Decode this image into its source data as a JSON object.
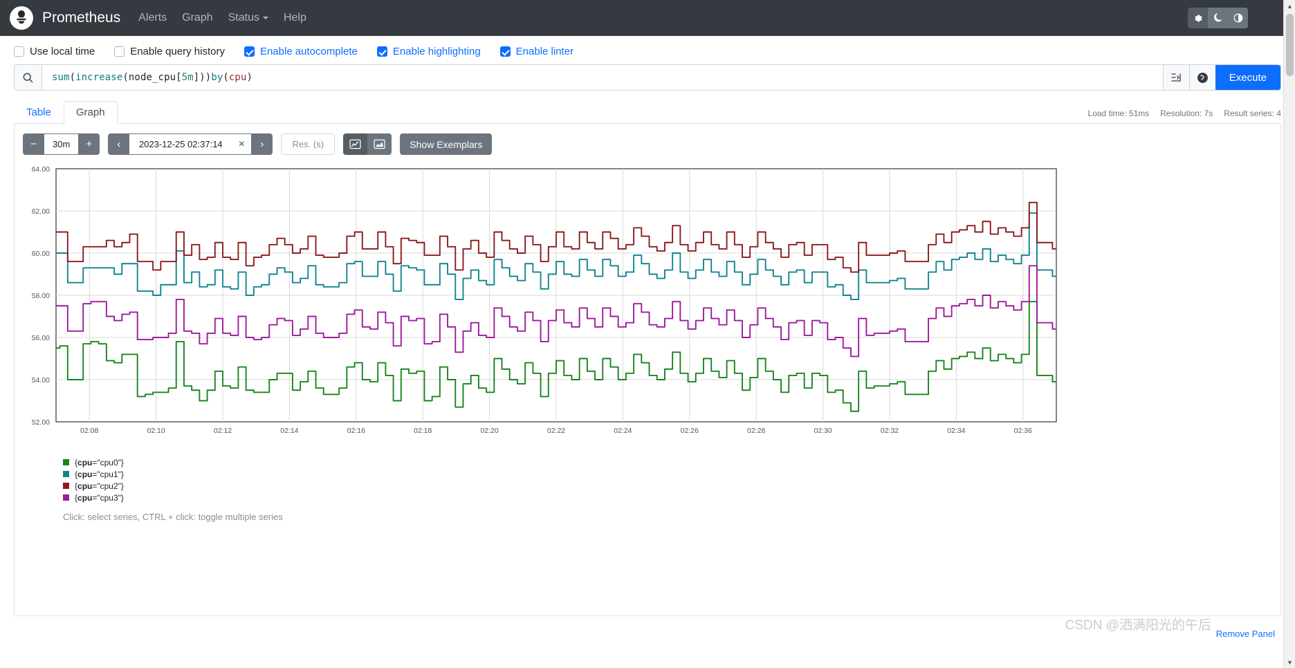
{
  "navbar": {
    "logo_icon": "prometheus-logo-icon",
    "brand": "Prometheus",
    "links": [
      {
        "label": "Alerts",
        "caret": false
      },
      {
        "label": "Graph",
        "caret": false
      },
      {
        "label": "Status",
        "caret": true
      },
      {
        "label": "Help",
        "caret": false
      }
    ],
    "theme_buttons": [
      {
        "name": "gear-icon",
        "glyph": "⚙",
        "selected": true
      },
      {
        "name": "moon-icon",
        "glyph": "☾",
        "selected": false
      },
      {
        "name": "contrast-icon",
        "glyph": "◑",
        "selected": false
      }
    ]
  },
  "options": [
    {
      "label": "Use local time",
      "checked": false,
      "accent": false
    },
    {
      "label": "Enable query history",
      "checked": false,
      "accent": false
    },
    {
      "label": "Enable autocomplete",
      "checked": true,
      "accent": true
    },
    {
      "label": "Enable highlighting",
      "checked": true,
      "accent": true
    },
    {
      "label": "Enable linter",
      "checked": true,
      "accent": true
    }
  ],
  "query": {
    "search_icon": "search-icon",
    "expression": "sum(increase(node_cpu[5m])) by (cpu)",
    "tokens": [
      {
        "t": "sum",
        "k": "fn"
      },
      {
        "t": "(",
        "k": "punc"
      },
      {
        "t": "increase",
        "k": "fn"
      },
      {
        "t": "(",
        "k": "punc"
      },
      {
        "t": "node_cpu",
        "k": "id"
      },
      {
        "t": "[",
        "k": "punc"
      },
      {
        "t": "5m",
        "k": "num"
      },
      {
        "t": "])) ",
        "k": "punc"
      },
      {
        "t": "by",
        "k": "kw"
      },
      {
        "t": " (",
        "k": "punc"
      },
      {
        "t": "cpu",
        "k": "lbl"
      },
      {
        "t": ")",
        "k": "punc"
      }
    ],
    "format_icon": "format-expression-icon",
    "metrics_explorer_icon": "metrics-explorer-icon",
    "execute_label": "Execute"
  },
  "tabs": [
    {
      "label": "Table",
      "active": false
    },
    {
      "label": "Graph",
      "active": true
    }
  ],
  "stats": {
    "load_time": "Load time: 51ms",
    "resolution": "Resolution: 7s",
    "result_series": "Result series: 4"
  },
  "graph_controls": {
    "decrease_range": "−",
    "range_value": "30m",
    "increase_range": "+",
    "prev_label": "‹",
    "end_time": "2023-12-25 02:37:14",
    "clear_time": "×",
    "next_label": "›",
    "resolution_placeholder": "Res. (s)",
    "resolution_value": "",
    "line_chart_icon": "line-chart-icon",
    "stacked_chart_icon": "stacked-chart-icon",
    "show_exemplars": "Show Exemplars"
  },
  "legend": {
    "items": [
      {
        "label_prefix": "{",
        "key": "cpu",
        "eq": "=",
        "value": "\"cpu0\"",
        "suffix": "}",
        "color": "#17841c"
      },
      {
        "label_prefix": "{",
        "key": "cpu",
        "eq": "=",
        "value": "\"cpu1\"",
        "suffix": "}",
        "color": "#0f8490"
      },
      {
        "label_prefix": "{",
        "key": "cpu",
        "eq": "=",
        "value": "\"cpu2\"",
        "suffix": "}",
        "color": "#8b1a1a"
      },
      {
        "label_prefix": "{",
        "key": "cpu",
        "eq": "=",
        "value": "\"cpu3\"",
        "suffix": "}",
        "color": "#9c1a9c"
      }
    ],
    "hint": "Click: select series, CTRL + click: toggle multiple series"
  },
  "footer": {
    "remove_panel": "Remove Panel",
    "watermark": "CSDN @洒满阳光的午后"
  },
  "chart_data": {
    "type": "line",
    "title": "",
    "xlabel": "",
    "ylabel": "",
    "ylim": [
      52.0,
      64.0
    ],
    "yticks": [
      52.0,
      54.0,
      56.0,
      58.0,
      60.0,
      62.0,
      64.0
    ],
    "ytick_labels": [
      "52.00",
      "54.00",
      "56.00",
      "58.00",
      "60.00",
      "62.00",
      "64.00"
    ],
    "xtick_labels": [
      "02:08",
      "02:10",
      "02:12",
      "02:14",
      "02:16",
      "02:18",
      "02:20",
      "02:22",
      "02:24",
      "02:26",
      "02:28",
      "02:30",
      "02:32",
      "02:34",
      "02:36"
    ],
    "xlim": [
      "02:07",
      "02:37"
    ],
    "grid": true,
    "legend_position": "below",
    "step_interpolation": true,
    "series": [
      {
        "name": "{cpu=\"cpu0\"}",
        "color": "#17841c",
        "values": [
          55.5,
          55.6,
          54.0,
          54.0,
          55.7,
          55.8,
          55.7,
          54.9,
          54.8,
          55.2,
          55.2,
          53.2,
          53.3,
          53.4,
          53.4,
          53.6,
          55.8,
          53.7,
          53.5,
          53.0,
          53.5,
          54.4,
          53.7,
          53.6,
          54.6,
          53.5,
          53.4,
          53.4,
          54.0,
          54.3,
          54.3,
          53.5,
          53.9,
          54.4,
          53.6,
          53.3,
          53.3,
          53.6,
          54.6,
          54.8,
          54.0,
          53.9,
          54.8,
          54.2,
          53.0,
          54.5,
          54.3,
          54.4,
          53.0,
          53.2,
          54.6,
          54.0,
          52.7,
          53.8,
          54.2,
          53.6,
          53.4,
          55.0,
          54.5,
          54.0,
          53.8,
          54.8,
          54.3,
          53.2,
          54.3,
          54.9,
          54.2,
          54.0,
          55.0,
          54.4,
          54.0,
          55.0,
          54.6,
          54.0,
          54.3,
          55.2,
          54.8,
          54.2,
          54.0,
          54.5,
          55.3,
          54.3,
          53.9,
          54.3,
          55.0,
          54.4,
          54.1,
          54.9,
          54.3,
          53.5,
          54.1,
          55.0,
          54.4,
          54.0,
          53.4,
          54.2,
          54.3,
          53.6,
          54.3,
          54.2,
          53.4,
          53.5,
          52.9,
          52.5,
          54.4,
          53.6,
          53.7,
          53.7,
          53.8,
          53.9,
          53.3,
          53.3,
          53.3,
          54.4,
          54.9,
          54.5,
          55.0,
          55.1,
          55.3,
          55.0,
          55.5,
          54.9,
          55.2,
          55.0,
          54.8,
          55.2,
          57.7,
          54.2,
          54.2,
          53.9
        ]
      },
      {
        "name": "{cpu=\"cpu1\"}",
        "color": "#0f8490",
        "values": [
          60.0,
          60.0,
          58.6,
          58.6,
          59.3,
          59.3,
          59.3,
          59.3,
          59.0,
          59.5,
          59.5,
          58.2,
          58.2,
          58.0,
          58.5,
          58.5,
          60.1,
          58.6,
          59.1,
          58.4,
          58.5,
          59.2,
          58.4,
          58.3,
          59.1,
          58.0,
          58.4,
          58.5,
          59.0,
          59.3,
          59.1,
          58.6,
          58.8,
          59.4,
          58.5,
          58.4,
          58.4,
          58.6,
          59.5,
          59.6,
          58.9,
          58.9,
          59.6,
          59.0,
          58.2,
          59.4,
          59.3,
          59.2,
          58.5,
          58.5,
          59.5,
          59.0,
          57.8,
          58.8,
          59.2,
          58.7,
          58.5,
          59.7,
          59.3,
          58.9,
          58.7,
          59.5,
          59.1,
          58.3,
          59.0,
          59.6,
          59.0,
          58.9,
          59.7,
          59.2,
          58.9,
          59.7,
          59.4,
          58.9,
          59.1,
          59.9,
          59.5,
          59.0,
          58.8,
          59.2,
          60.0,
          59.1,
          58.8,
          59.2,
          59.7,
          59.1,
          58.9,
          59.6,
          59.1,
          58.5,
          59.0,
          59.7,
          59.2,
          58.9,
          58.5,
          59.1,
          59.2,
          58.6,
          59.1,
          59.1,
          58.4,
          58.5,
          58.0,
          57.8,
          59.2,
          58.6,
          58.6,
          58.6,
          58.7,
          58.8,
          58.3,
          58.3,
          58.3,
          59.1,
          59.6,
          59.2,
          59.7,
          59.8,
          60.0,
          59.7,
          60.2,
          59.6,
          59.9,
          59.7,
          59.5,
          59.9,
          61.9,
          59.2,
          59.2,
          58.9
        ]
      },
      {
        "name": "{cpu=\"cpu2\"}",
        "color": "#8b1a1a",
        "values": [
          61.0,
          61.0,
          59.6,
          59.6,
          60.3,
          60.3,
          60.3,
          60.6,
          60.3,
          60.5,
          60.9,
          59.6,
          59.6,
          59.2,
          59.6,
          59.6,
          61.0,
          59.9,
          60.4,
          59.7,
          59.8,
          60.5,
          59.8,
          59.7,
          60.5,
          59.4,
          59.8,
          59.9,
          60.4,
          60.7,
          60.4,
          60.0,
          60.2,
          60.8,
          59.9,
          59.8,
          59.8,
          60.0,
          60.8,
          61.0,
          60.2,
          60.2,
          61.0,
          60.3,
          59.5,
          60.7,
          60.6,
          60.5,
          59.9,
          59.9,
          60.8,
          60.3,
          59.2,
          60.2,
          60.6,
          60.0,
          59.8,
          61.0,
          60.6,
          60.2,
          60.0,
          60.8,
          60.4,
          59.6,
          60.3,
          61.0,
          60.3,
          60.2,
          61.0,
          60.5,
          60.2,
          61.0,
          60.7,
          60.2,
          60.4,
          61.2,
          60.8,
          60.3,
          60.1,
          60.5,
          61.3,
          60.4,
          60.1,
          60.5,
          61.0,
          60.4,
          60.2,
          61.0,
          60.4,
          59.8,
          60.3,
          61.0,
          60.5,
          60.2,
          59.8,
          60.4,
          60.5,
          59.9,
          60.4,
          60.4,
          59.7,
          59.8,
          59.3,
          59.1,
          60.5,
          59.9,
          59.9,
          59.9,
          60.0,
          60.1,
          59.6,
          59.6,
          59.6,
          60.4,
          60.9,
          60.5,
          61.0,
          61.1,
          61.3,
          61.0,
          61.5,
          60.9,
          61.2,
          61.0,
          60.8,
          61.2,
          62.4,
          60.5,
          60.5,
          60.2
        ]
      },
      {
        "name": "{cpu=\"cpu3\"}",
        "color": "#9c1a9c",
        "values": [
          57.5,
          57.5,
          56.3,
          56.3,
          57.6,
          57.7,
          57.7,
          57.0,
          56.8,
          57.1,
          57.2,
          55.9,
          55.9,
          56.0,
          56.0,
          56.2,
          57.8,
          56.3,
          56.2,
          55.7,
          56.2,
          56.9,
          56.2,
          56.1,
          57.0,
          56.0,
          55.9,
          56.0,
          56.6,
          56.9,
          56.8,
          56.1,
          56.4,
          57.0,
          56.2,
          56.0,
          56.0,
          56.2,
          57.1,
          57.3,
          56.5,
          56.4,
          57.2,
          56.7,
          55.6,
          57.0,
          56.8,
          56.9,
          55.7,
          55.8,
          57.1,
          56.5,
          55.3,
          56.3,
          56.7,
          56.1,
          56.0,
          57.4,
          57.0,
          56.5,
          56.3,
          57.2,
          56.8,
          55.8,
          56.8,
          57.3,
          56.7,
          56.5,
          57.4,
          56.9,
          56.5,
          57.4,
          57.0,
          56.5,
          56.7,
          57.6,
          57.2,
          56.6,
          56.5,
          56.9,
          57.7,
          56.8,
          56.4,
          56.8,
          57.4,
          56.9,
          56.6,
          57.3,
          56.8,
          56.0,
          56.6,
          57.4,
          56.9,
          56.5,
          55.9,
          56.7,
          56.8,
          56.1,
          56.8,
          56.7,
          55.9,
          56.0,
          55.5,
          55.1,
          56.9,
          56.1,
          56.2,
          56.2,
          56.3,
          56.4,
          55.8,
          55.8,
          55.8,
          56.9,
          57.4,
          57.0,
          57.5,
          57.6,
          57.8,
          57.5,
          58.0,
          57.4,
          57.7,
          57.5,
          57.3,
          57.7,
          59.4,
          56.7,
          56.7,
          56.4
        ]
      }
    ]
  }
}
